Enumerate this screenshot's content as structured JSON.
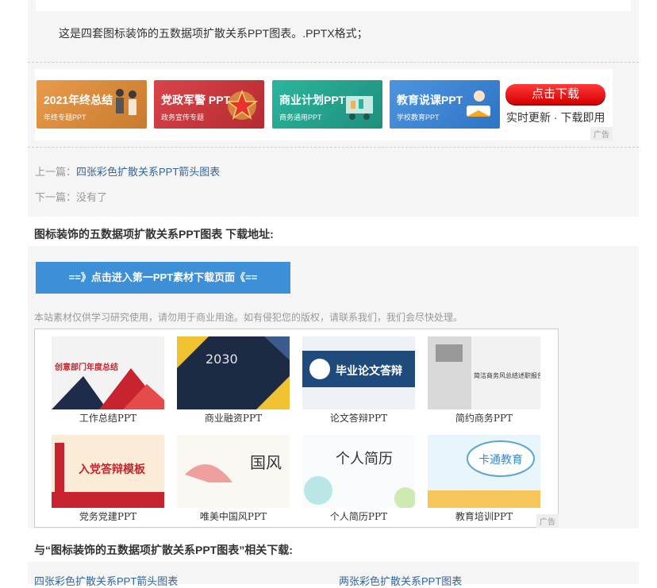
{
  "description": "这是四套图标装饰的五数据项扩散关系PPT图表。.PPTX格式；",
  "ad_banner": {
    "cards": [
      {
        "title": "2021年终总结",
        "subtitle": "年终专题PPT",
        "color": "#d88a3c",
        "icon": "people-icon"
      },
      {
        "title": "党政军警 PPT",
        "subtitle": "政务宣传专题",
        "color": "#c9353b",
        "icon": "star-icon"
      },
      {
        "title": "商业计划PPT",
        "subtitle": "商务通用PPT",
        "color": "#25a28f",
        "icon": "business-people-icon"
      },
      {
        "title": "教育说课PPT",
        "subtitle": "学校教育PPT",
        "color": "#3f86d6",
        "icon": "student-icon"
      }
    ],
    "button": "点击下载",
    "sub": "实时更新 · 下载即用",
    "tag": "广告"
  },
  "nav": {
    "prev_label": "上一篇：",
    "prev_link": "四张彩色扩散关系PPT箭头图表",
    "next_label": "下一篇：",
    "next_text": "没有了"
  },
  "download": {
    "heading": "图标装饰的五数据项扩散关系PPT图表 下载地址:",
    "button": "==》点击进入第一PPT素材下载页面《==",
    "notice": "本站素材仅供学习研究使用，请勿用于商业用途。如有侵犯您的版权，请联系我们，我们会尽快处理。"
  },
  "templates": {
    "items": [
      {
        "caption": "工作总结PPT",
        "thumb_text": "创意部门年度总结"
      },
      {
        "caption": "商业融资PPT",
        "thumb_text": "2030"
      },
      {
        "caption": "论文答辩PPT",
        "thumb_text": "毕业论文答辩"
      },
      {
        "caption": "简约商务PPT",
        "thumb_text": "简洁商务风总结述职报告"
      },
      {
        "caption": "党务党建PPT",
        "thumb_text": "入党答辩模板"
      },
      {
        "caption": "唯美中国风PPT",
        "thumb_text": "国风"
      },
      {
        "caption": "个人简历PPT",
        "thumb_text": "个人简历"
      },
      {
        "caption": "教育培训PPT",
        "thumb_text": "卡通教育"
      }
    ],
    "tag": "广告"
  },
  "related": {
    "heading": "与“图标装饰的五数据项扩散关系PPT图表”相关下载:",
    "links": [
      "四张彩色扩散关系PPT箭头图表",
      "两张彩色扩散关系PPT图表"
    ]
  }
}
